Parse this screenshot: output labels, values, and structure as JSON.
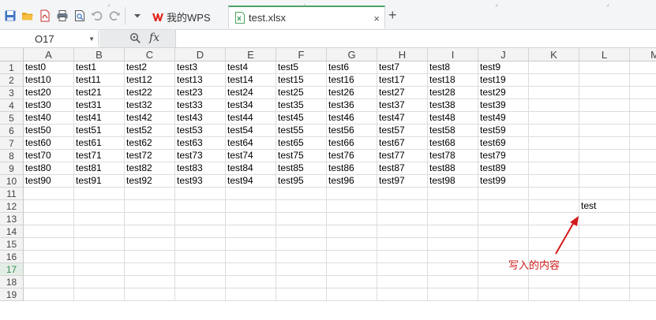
{
  "toolbar": {
    "quick_icons": [
      "save-icon",
      "open-icon",
      "export-pdf-icon",
      "print-icon",
      "print-preview-icon",
      "undo-icon",
      "redo-icon",
      "dropdown-icon"
    ],
    "tabs": [
      {
        "label": "我的WPS",
        "icon": "wps-logo-icon"
      },
      {
        "label": "test.xlsx",
        "icon": "spreadsheet-file-icon",
        "active": true
      }
    ],
    "close_glyph": "×",
    "add_glyph": "+"
  },
  "formula_bar": {
    "name_box": "O17",
    "fx_label": "fx",
    "formula": ""
  },
  "sheet": {
    "columns": [
      "A",
      "B",
      "C",
      "D",
      "E",
      "F",
      "G",
      "H",
      "I",
      "J",
      "K",
      "L",
      "M"
    ],
    "row_numbers": [
      "1",
      "2",
      "3",
      "4",
      "5",
      "6",
      "7",
      "8",
      "9",
      "10",
      "11",
      "12",
      "13",
      "14",
      "15",
      "16",
      "17",
      "18",
      "19"
    ],
    "active_row": "17",
    "data_rows": [
      [
        "test0",
        "test1",
        "test2",
        "test3",
        "test4",
        "test5",
        "test6",
        "test7",
        "test8",
        "test9"
      ],
      [
        "test10",
        "test11",
        "test12",
        "test13",
        "test14",
        "test15",
        "test16",
        "test17",
        "test18",
        "test19"
      ],
      [
        "test20",
        "test21",
        "test22",
        "test23",
        "test24",
        "test25",
        "test26",
        "test27",
        "test28",
        "test29"
      ],
      [
        "test30",
        "test31",
        "test32",
        "test33",
        "test34",
        "test35",
        "test36",
        "test37",
        "test38",
        "test39"
      ],
      [
        "test40",
        "test41",
        "test42",
        "test43",
        "test44",
        "test45",
        "test46",
        "test47",
        "test48",
        "test49"
      ],
      [
        "test50",
        "test51",
        "test52",
        "test53",
        "test54",
        "test55",
        "test56",
        "test57",
        "test58",
        "test59"
      ],
      [
        "test60",
        "test61",
        "test62",
        "test63",
        "test64",
        "test65",
        "test66",
        "test67",
        "test68",
        "test69"
      ],
      [
        "test70",
        "test71",
        "test72",
        "test73",
        "test74",
        "test75",
        "test76",
        "test77",
        "test78",
        "test79"
      ],
      [
        "test80",
        "test81",
        "test82",
        "test83",
        "test84",
        "test85",
        "test86",
        "test87",
        "test88",
        "test89"
      ],
      [
        "test90",
        "test91",
        "test92",
        "test93",
        "test94",
        "test95",
        "test96",
        "test97",
        "test98",
        "test99"
      ]
    ],
    "written_cell": {
      "ref": "L12",
      "value": "test"
    }
  },
  "annotation": {
    "text": "写入的内容",
    "color": "#d11a1a"
  },
  "colors": {
    "active_tab_accent": "#4ba564",
    "wps_logo": "#e2261c"
  }
}
